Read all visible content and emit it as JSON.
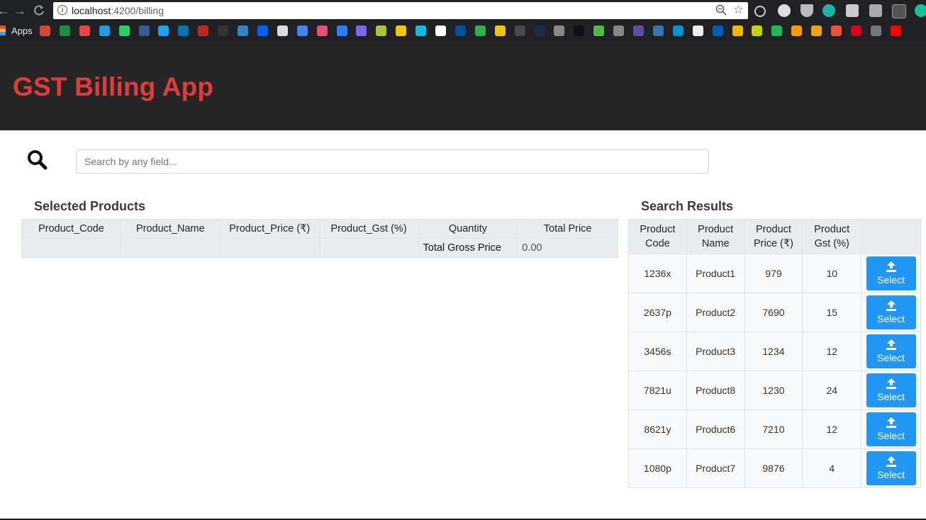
{
  "browser": {
    "url_host": "localhost",
    "url_path": ":4200/billing",
    "bookmarks_label": "Apps"
  },
  "app": {
    "title": "GST Billing App",
    "accent_color": "#e33b3b",
    "header_bg": "#262626"
  },
  "search": {
    "icon": "search-icon",
    "placeholder": "Search by any field...",
    "value": ""
  },
  "selected": {
    "title": "Selected Products",
    "columns": [
      "Product_Code",
      "Product_Name",
      "Product_Price (₹)",
      "Product_Gst (%)",
      "Quantity",
      "Total Price"
    ],
    "total_label": "Total Gross Price",
    "total_value": "0.00"
  },
  "results": {
    "title": "Search Results",
    "columns": [
      "Product Code",
      "Product Name",
      "Product Price (₹)",
      "Product Gst (%)",
      ""
    ],
    "select_label": "Select",
    "select_icon": "upload-icon",
    "button_color": "#2196f3",
    "rows": [
      {
        "code": "1236x",
        "name": "Product1",
        "price": "979",
        "gst": "10"
      },
      {
        "code": "2637p",
        "name": "Product2",
        "price": "7690",
        "gst": "15"
      },
      {
        "code": "3456s",
        "name": "Product3",
        "price": "1234",
        "gst": "12"
      },
      {
        "code": "7821u",
        "name": "Product8",
        "price": "1230",
        "gst": "24"
      },
      {
        "code": "8621y",
        "name": "Product6",
        "price": "7210",
        "gst": "12"
      },
      {
        "code": "1080p",
        "name": "Product7",
        "price": "9876",
        "gst": "4"
      }
    ]
  }
}
